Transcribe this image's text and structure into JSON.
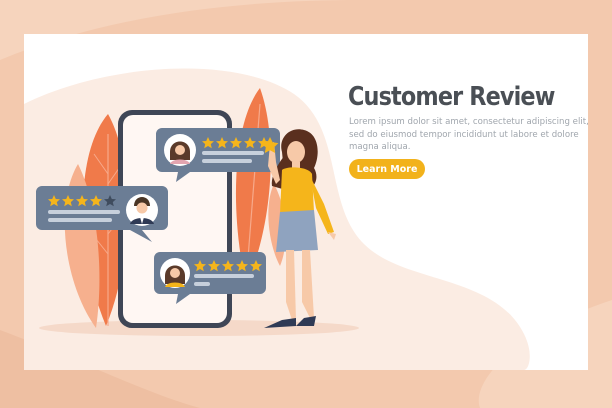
{
  "hero": {
    "title": "Customer Review",
    "description": "Lorem ipsum dolor sit amet, consectetur adipiscing elit, sed do eiusmod tempor incididunt ut labore et dolore magna aliqua.",
    "cta_label": "Learn More"
  },
  "reviews": [
    {
      "avatar": "woman-avatar-icon",
      "rating": 5,
      "rating_max": 5
    },
    {
      "avatar": "man-avatar-icon",
      "rating": 4,
      "rating_max": 5
    },
    {
      "avatar": "woman-avatar-icon",
      "rating": 5,
      "rating_max": 5
    }
  ],
  "colors": {
    "page_background": "#f3c9ae",
    "card": "#ffffff",
    "bubble": "#6b7d95",
    "star_filled": "#f5b51b",
    "star_empty": "#3f4c5e",
    "accent_button": "#f2b21b",
    "leaf": "#f07a4a",
    "title_text": "#4a4f55",
    "body_text": "#a0a6ad"
  }
}
